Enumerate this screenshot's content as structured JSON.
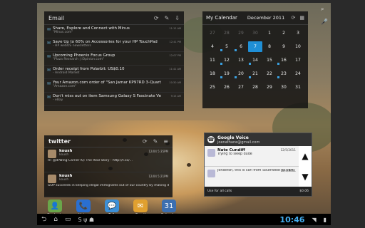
{
  "email": {
    "title": "Email",
    "items": [
      {
        "subject": "Share, Explore and Connect with Minus",
        "from": "\"Minus.com\"",
        "time": "11:12 AM"
      },
      {
        "subject": "Save Up to 60% on Accessories for your HP TouchPad",
        "from": "- HP webOS newsletters",
        "time": "12:41 PM"
      },
      {
        "subject": "Upcoming Phoenix Focus Group",
        "from": "\"Plaza Research | iOpinion.com\"",
        "time": "12:07 PM"
      },
      {
        "subject": "Order receipt from Polarbit: US$0.10",
        "from": "- Android Market",
        "time": "11:41 AM"
      },
      {
        "subject": "Your Amazon.com order of \"San Jamar KP97RD 3-Quart R...\"",
        "from": "\"Amazon.com\"",
        "time": "10:30 AM"
      },
      {
        "subject": "Don't miss out on item Samsung Galaxy S Fascinate Verizon B...",
        "from": "- eBay",
        "time": "9:15 AM"
      }
    ]
  },
  "calendar": {
    "title": "My Calendar",
    "month": "December 2011",
    "days": [
      {
        "d": "27",
        "dim": true
      },
      {
        "d": "28",
        "dim": true
      },
      {
        "d": "29",
        "dim": true
      },
      {
        "d": "30",
        "dim": true
      },
      {
        "d": "1"
      },
      {
        "d": "2"
      },
      {
        "d": "3"
      },
      {
        "d": "4"
      },
      {
        "d": "5",
        "evt": true
      },
      {
        "d": "6",
        "evt": true
      },
      {
        "d": "7",
        "today": true
      },
      {
        "d": "8"
      },
      {
        "d": "9"
      },
      {
        "d": "10"
      },
      {
        "d": "11"
      },
      {
        "d": "12",
        "evt": true
      },
      {
        "d": "13"
      },
      {
        "d": "14",
        "evt": true
      },
      {
        "d": "15"
      },
      {
        "d": "16",
        "evt": true
      },
      {
        "d": "17"
      },
      {
        "d": "18"
      },
      {
        "d": "19",
        "evt": true
      },
      {
        "d": "20",
        "evt": true
      },
      {
        "d": "21",
        "evt": true
      },
      {
        "d": "22"
      },
      {
        "d": "23",
        "evt": true
      },
      {
        "d": "24"
      },
      {
        "d": "25"
      },
      {
        "d": "26"
      },
      {
        "d": "27"
      },
      {
        "d": "28"
      },
      {
        "d": "29"
      },
      {
        "d": "30"
      },
      {
        "d": "31"
      }
    ]
  },
  "twitter": {
    "title": "twitter",
    "tweets": [
      {
        "user": "koush",
        "handle": "koush",
        "time": "12/04 5:35PM",
        "text": "RT @drWing Carrier IQ: The Real Story - http://t.co/..."
      },
      {
        "user": "koush",
        "handle": "koush",
        "time": "12/04 5:21PM",
        "text": "GOP succeeds in keeping illegal immigrants out of our country by making it"
      }
    ]
  },
  "voice": {
    "title": "Google Voice",
    "account": "joenathane@gmail.com",
    "items": [
      {
        "name": "Nate Cundiff",
        "msg": "Trying to sleep dude",
        "date": "12/5/2011"
      },
      {
        "name": "",
        "msg": "Jonathon, this is carl from Southwest all cars. Wanted to ask you about a week or so ago about",
        "date": "12/4/2011"
      }
    ],
    "footer_left": "Use for all calls",
    "footer_right": "$0.06"
  },
  "dock": [
    {
      "label": "Contacts",
      "color": "#6aa64a",
      "icon": "👤"
    },
    {
      "label": "Voice",
      "color": "#2a6fd0",
      "icon": "📞"
    },
    {
      "label": "Talk",
      "color": "#3c8fd6",
      "icon": "💬"
    },
    {
      "label": "Email",
      "color": "#e0a030",
      "icon": "✉"
    },
    {
      "label": "Calendar",
      "color": "#3c6fb0",
      "icon": "31"
    }
  ],
  "status": {
    "time": "10:46"
  }
}
